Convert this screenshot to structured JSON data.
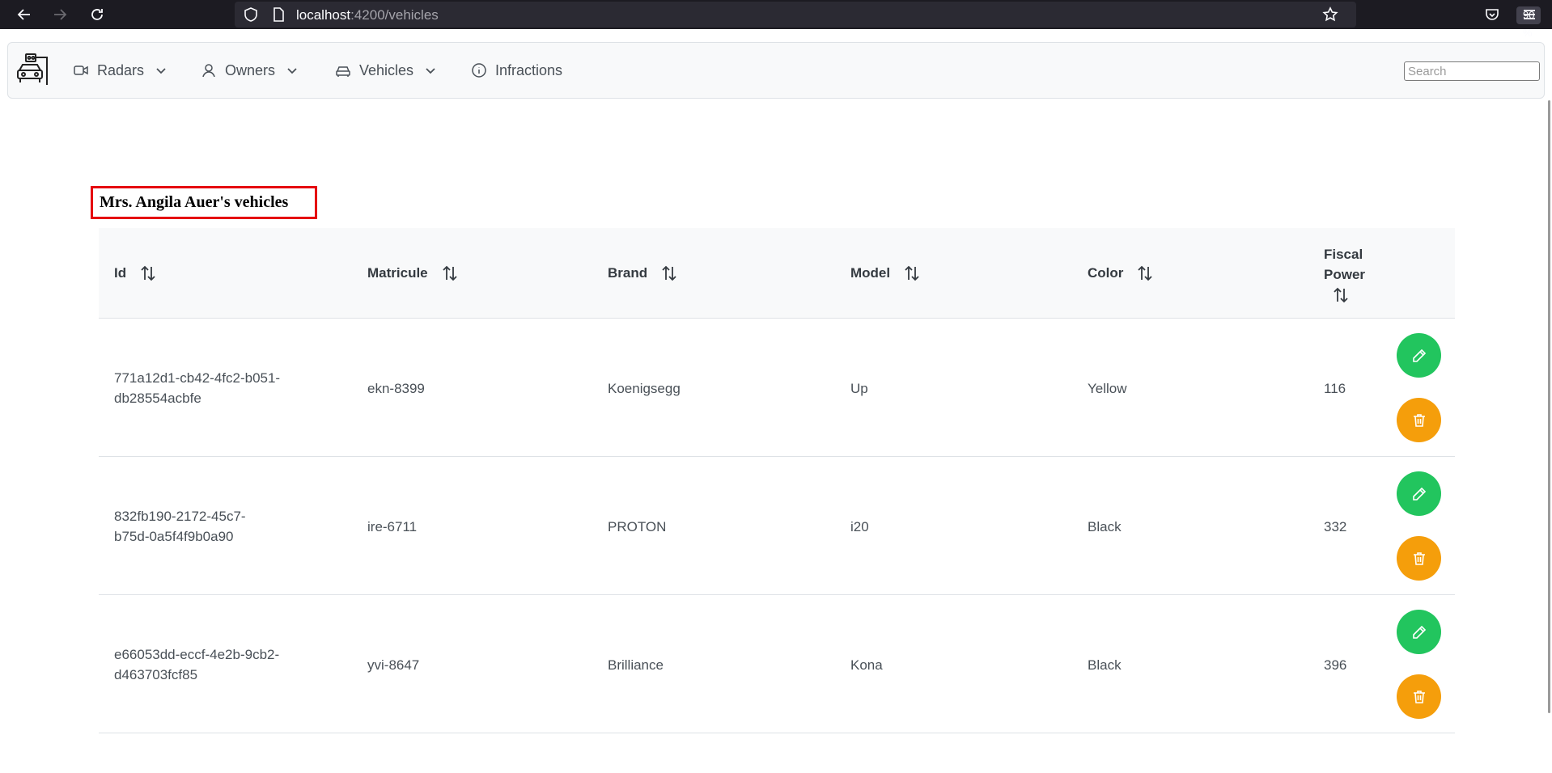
{
  "browser": {
    "url_host": "localhost",
    "url_path": ":4200/vehicles",
    "zoom": "90 %"
  },
  "nav": {
    "items": [
      {
        "label": "Radars",
        "icon": "video-camera-icon",
        "dropdown": true
      },
      {
        "label": "Owners",
        "icon": "user-icon",
        "dropdown": true
      },
      {
        "label": "Vehicles",
        "icon": "car-icon",
        "dropdown": true
      },
      {
        "label": "Infractions",
        "icon": "info-circle-icon",
        "dropdown": false
      }
    ],
    "search_placeholder": "Search"
  },
  "page": {
    "title": "Mrs. Angila Auer's vehicles"
  },
  "table": {
    "columns": [
      "Id",
      "Matricule",
      "Brand",
      "Model",
      "Color",
      "Fiscal Power"
    ],
    "fiscal_line1": "Fiscal",
    "fiscal_line2": "Power",
    "rows": [
      {
        "id_line1": "771a12d1-cb42-4fc2-b051-",
        "id_line2": "db28554acbfe",
        "matricule": "ekn-8399",
        "brand": "Koenigsegg",
        "model": "Up",
        "color": "Yellow",
        "fiscal_power": "116"
      },
      {
        "id_line1": "832fb190-2172-45c7-",
        "id_line2": "b75d-0a5f4f9b0a90",
        "matricule": "ire-6711",
        "brand": "PROTON",
        "model": "i20",
        "color": "Black",
        "fiscal_power": "332"
      },
      {
        "id_line1": "e66053dd-eccf-4e2b-9cb2-",
        "id_line2": "d463703fcf85",
        "matricule": "yvi-8647",
        "brand": "Brilliance",
        "model": "Kona",
        "color": "Black",
        "fiscal_power": "396"
      }
    ]
  },
  "colors": {
    "edit_button": "#22c55e",
    "delete_button": "#f59e0b",
    "title_border": "#e5000f"
  }
}
